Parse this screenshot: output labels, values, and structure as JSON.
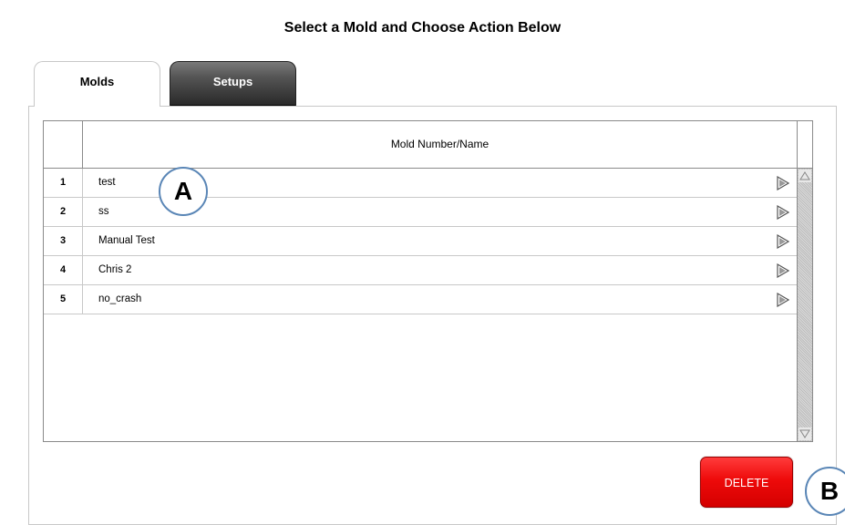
{
  "page": {
    "title": "Select a Mold and Choose Action Below"
  },
  "tabs": [
    {
      "label": "Molds",
      "active": true
    },
    {
      "label": "Setups",
      "active": false
    }
  ],
  "table": {
    "column_header": "Mold Number/Name",
    "rows": [
      {
        "num": "1",
        "name": "test"
      },
      {
        "num": "2",
        "name": "ss"
      },
      {
        "num": "3",
        "name": "Manual Test"
      },
      {
        "num": "4",
        "name": "Chris 2"
      },
      {
        "num": "5",
        "name": "no_crash"
      }
    ],
    "row_action_icon": "play-arrow-icon"
  },
  "actions": {
    "delete_label": "DELETE",
    "delete_color": "#ee0a0a"
  },
  "callouts": {
    "a": "A",
    "b": "B",
    "border_color": "#5a86b6"
  }
}
